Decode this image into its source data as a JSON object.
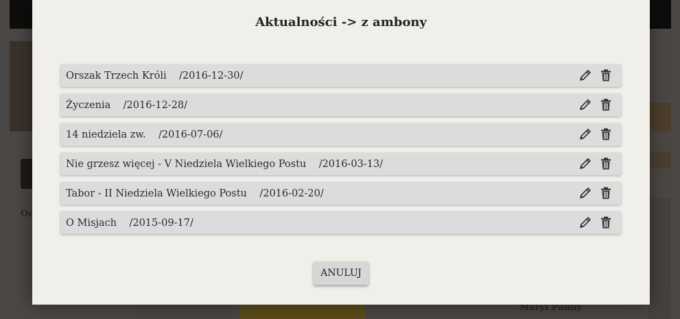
{
  "background": {
    "left_text": "Or",
    "caption": "Maryi Panny"
  },
  "modal": {
    "title": "Aktualności -> z ambony",
    "items": [
      {
        "title": "Orszak Trzech Króli",
        "date": "/2016-12-30/"
      },
      {
        "title": "Życzenia",
        "date": "/2016-12-28/"
      },
      {
        "title": "14 niedziela zw.",
        "date": "/2016-07-06/"
      },
      {
        "title": "Nie grzesz więcej - V Niedziela Wielkiego Postu",
        "date": "/2016-03-13/"
      },
      {
        "title": "Tabor - II Niedziela Wielkiego Postu",
        "date": "/2016-02-20/"
      },
      {
        "title": "O Misjach",
        "date": "/2015-09-17/"
      }
    ],
    "cancel_label": "ANULUJ"
  },
  "icons": {
    "edit": "pencil-icon",
    "delete": "trash-icon"
  }
}
